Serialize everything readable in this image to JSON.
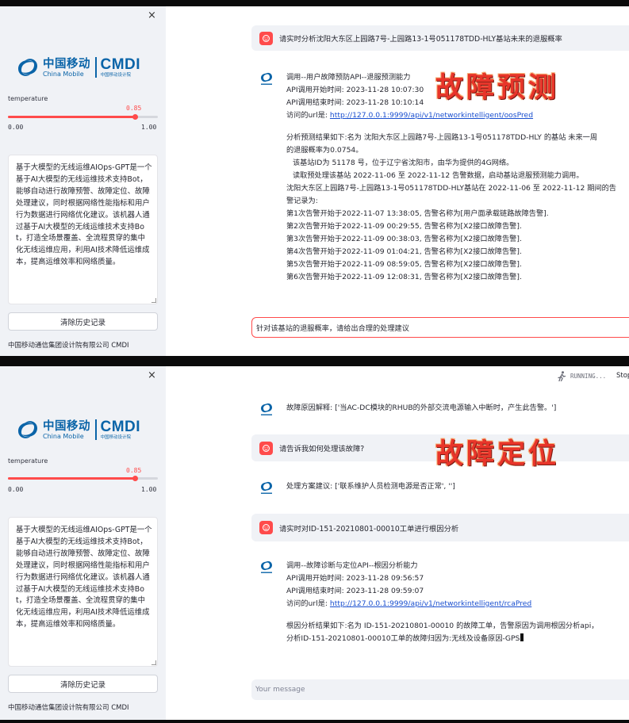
{
  "sidebar": {
    "logo": {
      "cn": "中国移动",
      "en": "China Mobile",
      "cmdi": "CMDI",
      "sub": "中国移动设计院"
    },
    "temperature_label": "temperature",
    "temperature_value": "0.85",
    "temperature_fraction": 0.85,
    "slider_min": "0.00",
    "slider_max": "1.00",
    "description": "基于大模型的无线运维AIOps-GPT是一个基于AI大模型的无线运维技术支持Bot，能够自动进行故障预警、故障定位、故障处理建议，同时根据网络性能指标和用户行为数据进行网络优化建议。该机器人通过基于AI大模型的无线运维技术支持Bot，打造全场景覆盖、全流程贯穿的集中化无线运维应用，利用AI技术降低运维成本，提高运维效率和网络质量。",
    "clear_button": "清除历史记录",
    "footer": "中国移动通信集团设计院有限公司 CMDI",
    "close_glyph": "×"
  },
  "top": {
    "overlay_title": "故障预测",
    "user_message": "请实时分析沈阳大东区上园路7号-上园路13-1号051178TDD-HLY基站未来的退服概率",
    "bot": {
      "l1": "调用--用户故障预防API--退服预测能力",
      "l2": "API调用开始时间:  2023-11-28 10:07:30",
      "l3": "API调用结束时间:  2023-11-28 10:10:14",
      "l4_prefix": "访问的url是:  ",
      "l4_url": "http://127.0.0.1:9999/api/v1/networkintelligent/oosPred",
      "l5": "分析预测结果如下:名为 沈阳大东区上园路7号-上园路13-1号051178TDD-HLY 的基站 未来一周",
      "l6": "的退服概率为0.0754。",
      "l7": "该基站ID为 51178 号，位于辽宁省沈阳市，由华为提供的4G网络。",
      "l8": "读取预处理该基站 2022-11-06 至 2022-11-12 告警数据，启动基站退服预测能力调用。",
      "l9": "沈阳大东区上园路7号-上园路13-1号051178TDD-HLY基站在 2022-11-06 至 2022-11-12 期间的告",
      "l10": "警记录为:",
      "alarms": [
        "第1次告警开始于2022-11-07 13:38:05, 告警名称为[用户面承载链路故障告警].",
        "第2次告警开始于2022-11-09 00:29:55, 告警名称为[X2接口故障告警].",
        "第3次告警开始于2022-11-09 00:38:03, 告警名称为[X2接口故障告警].",
        "第4次告警开始于2022-11-09 01:04:21, 告警名称为[X2接口故障告警].",
        "第5次告警开始于2022-11-09 08:59:05, 告警名称为[X2接口故障告警].",
        "第6次告警开始于2022-11-09 12:08:31, 告警名称为[X2接口故障告警]."
      ]
    },
    "input_value": "针对该基站的退服概率，请给出合理的处理建议"
  },
  "bottom": {
    "overlay_title": "故障定位",
    "running": "RUNNING...",
    "stop": "Stop",
    "bot1": "故障原因解释: ['当AC-DC模块的RHUB的外部交流电源输入中断时，产生此告警。']",
    "user1": "请告诉我如何处理该故障?",
    "bot2": "处理方案建议: ['联系维护人员检测电源是否正常', '']",
    "user2": "请实时对ID-151-20210801-00010工单进行根因分析",
    "bot3": {
      "l1": "调用--故障诊断与定位API--根因分析能力",
      "l2": "API调用开始时间:  2023-11-28 09:56:57",
      "l3": "API调用结束时间:  2023-11-28 09:59:07",
      "l4_prefix": "访问的url是:  ",
      "l4_url": "http://127.0.0.1:9999/api/v1/networkintelligent/rcaPred",
      "l5": "根因分析结果如下:名为 ID-151-20210801-00010 的故障工单，告警原因为调用根因分析api，",
      "l6": "分析ID-151-20210801-00010工单的故障归因为:无线及设备原因-GPS"
    },
    "input_placeholder": "Your message"
  },
  "colors": {
    "accent": "#ff4b4b",
    "brand": "#0a64a8",
    "overlay": "#e8352a",
    "link": "#1a4fcf"
  },
  "icons": [
    "close-icon",
    "china-mobile-logo-icon",
    "user-avatar-icon",
    "bot-avatar-icon",
    "send-icon",
    "running-man-icon"
  ]
}
